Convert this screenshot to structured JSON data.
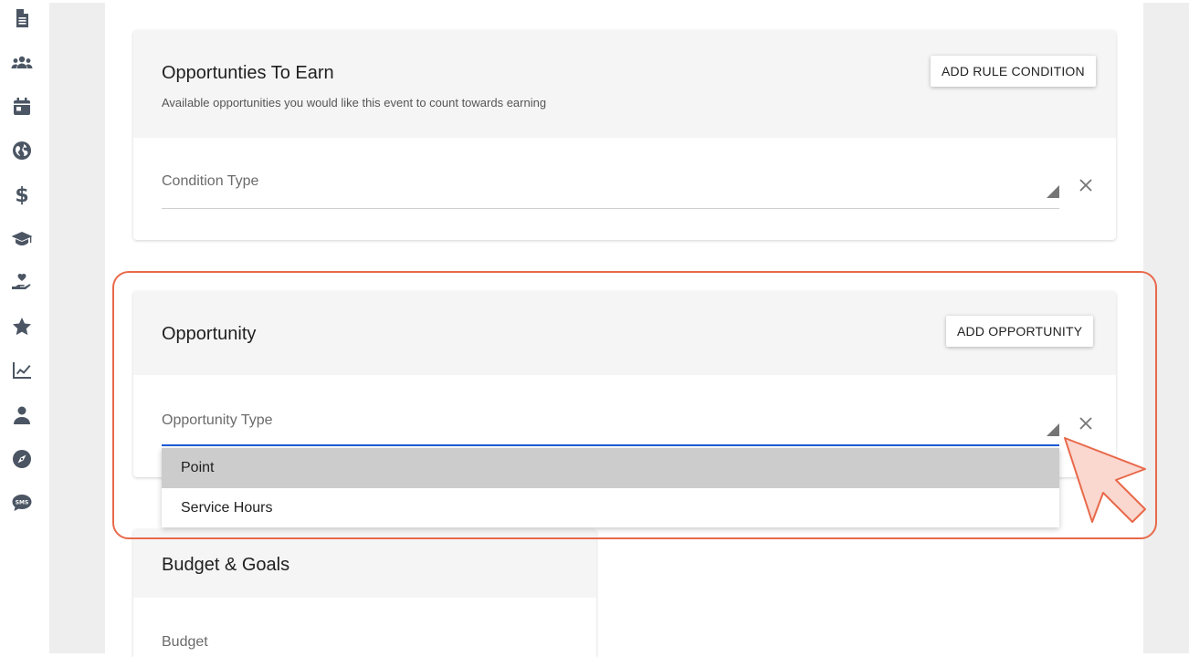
{
  "sidebar": {
    "icons": [
      "document-icon",
      "users-icon",
      "calendar-icon",
      "globe-icon",
      "dollar-icon",
      "graduation-cap-icon",
      "hand-heart-icon",
      "star-icon",
      "chart-line-icon",
      "user-icon",
      "compass-icon",
      "sms-icon"
    ]
  },
  "opportunities_card": {
    "title": "Opportunties To Earn",
    "subtitle": "Available opportunities you would like this event to count towards earning",
    "button_label": "ADD RULE CONDITION",
    "field_label": "Condition Type"
  },
  "opportunity_card": {
    "title": "Opportunity",
    "button_label": "ADD OPPORTUNITY",
    "field_label": "Opportunity Type"
  },
  "dropdown": {
    "options": [
      "Point",
      "Service Hours"
    ],
    "selected": "Point"
  },
  "budget_card": {
    "title": "Budget & Goals",
    "field_label": "Budget"
  },
  "colors": {
    "accent_blue": "#1e5bd6",
    "highlight": "#e8694a",
    "cursor_fill": "#fad7cf",
    "sidebar_icon": "#4b5563"
  }
}
